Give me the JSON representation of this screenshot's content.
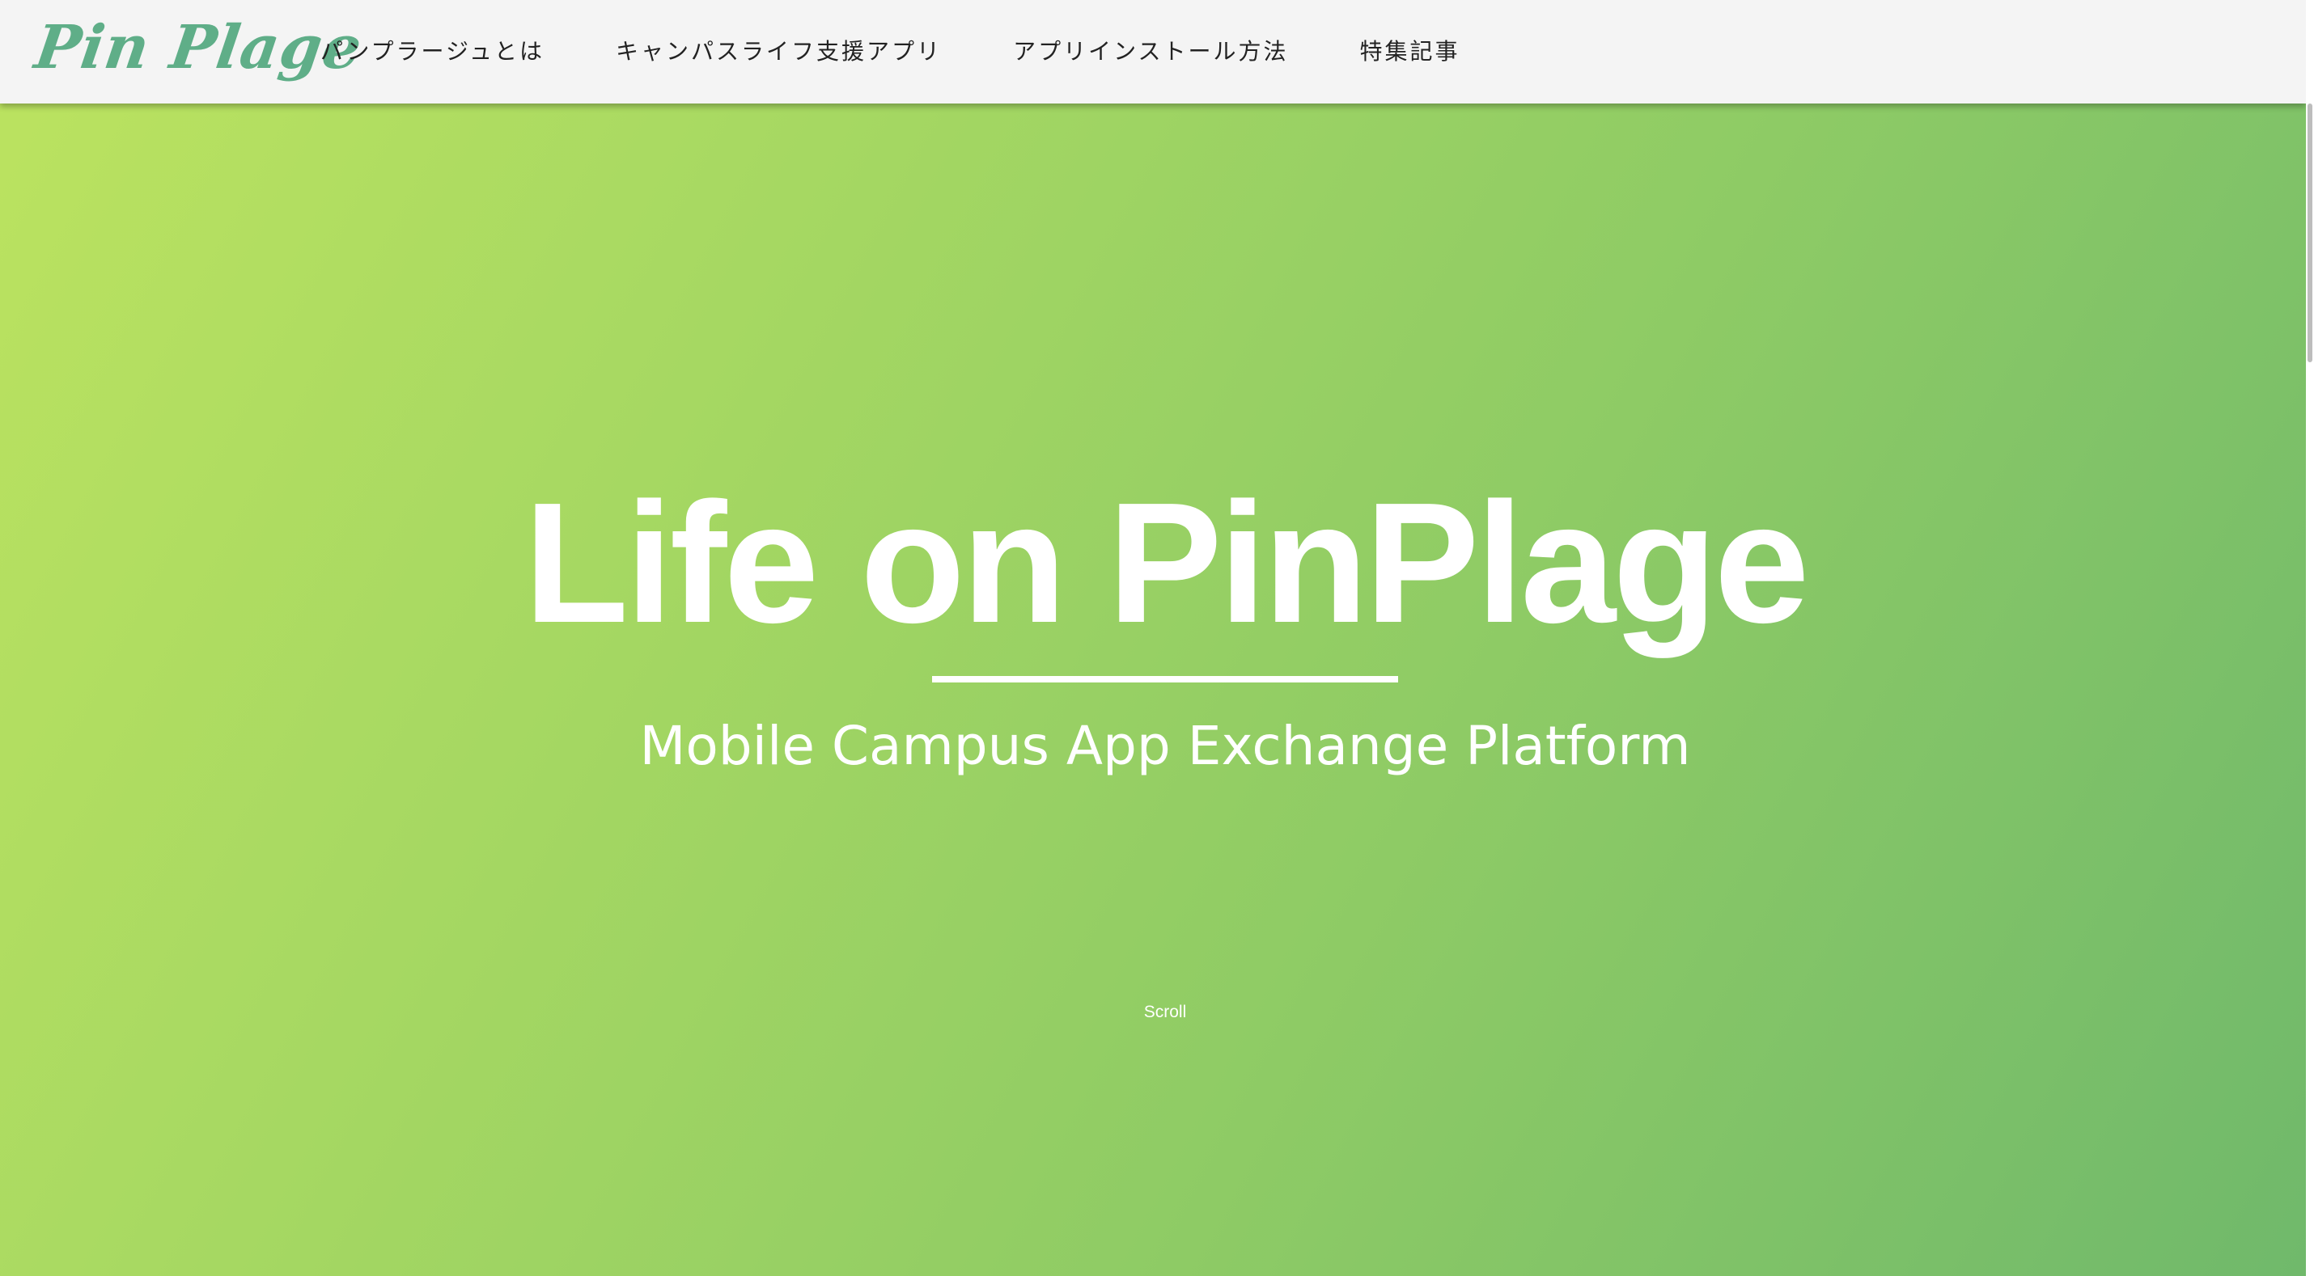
{
  "header": {
    "logo_text": "Pin Plage",
    "nav": [
      {
        "label": "パンプラージュとは"
      },
      {
        "label": "キャンパスライフ支援アプリ"
      },
      {
        "label": "アプリインストール方法"
      },
      {
        "label": "特集記事"
      }
    ]
  },
  "hero": {
    "title": "Life on PinPlage",
    "subtitle": "Mobile Campus App Exchange Platform",
    "scroll_label": "Scroll",
    "gradient_start": "#bce360",
    "gradient_end": "#70b96b"
  },
  "colors": {
    "header_bg": "#f4f4f4",
    "logo": "#5fae88",
    "nav_text": "#222222",
    "hero_text": "#ffffff"
  }
}
